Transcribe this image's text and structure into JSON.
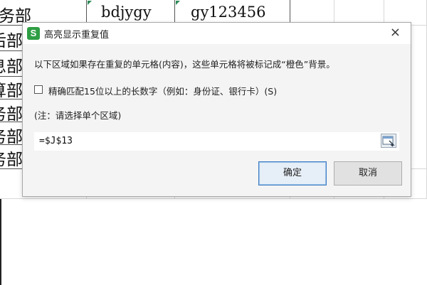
{
  "sheet": {
    "row_fragments": [
      "务部",
      "后部",
      "息部",
      "算部",
      "务部",
      "务部",
      "务部"
    ],
    "cells": [
      "bdjygy",
      "gy123456"
    ]
  },
  "dialog": {
    "title": "高亮显示重复值",
    "app_icon_letter": "S",
    "close_label": "×",
    "description": "以下区域如果存在重复的单元格(内容)，这些单元格将被标记成“橙色”背景。",
    "checkbox_label": "精确匹配15位以上的长数字（例如：身份证、银行卡）(S)",
    "checkbox_checked": false,
    "note": "(注：请选择单个区域)",
    "range_value": "=$J$13",
    "ok_label": "确定",
    "cancel_label": "取消"
  },
  "colors": {
    "app_icon": "#2f9e44",
    "ok_border": "#3f7ec3"
  }
}
